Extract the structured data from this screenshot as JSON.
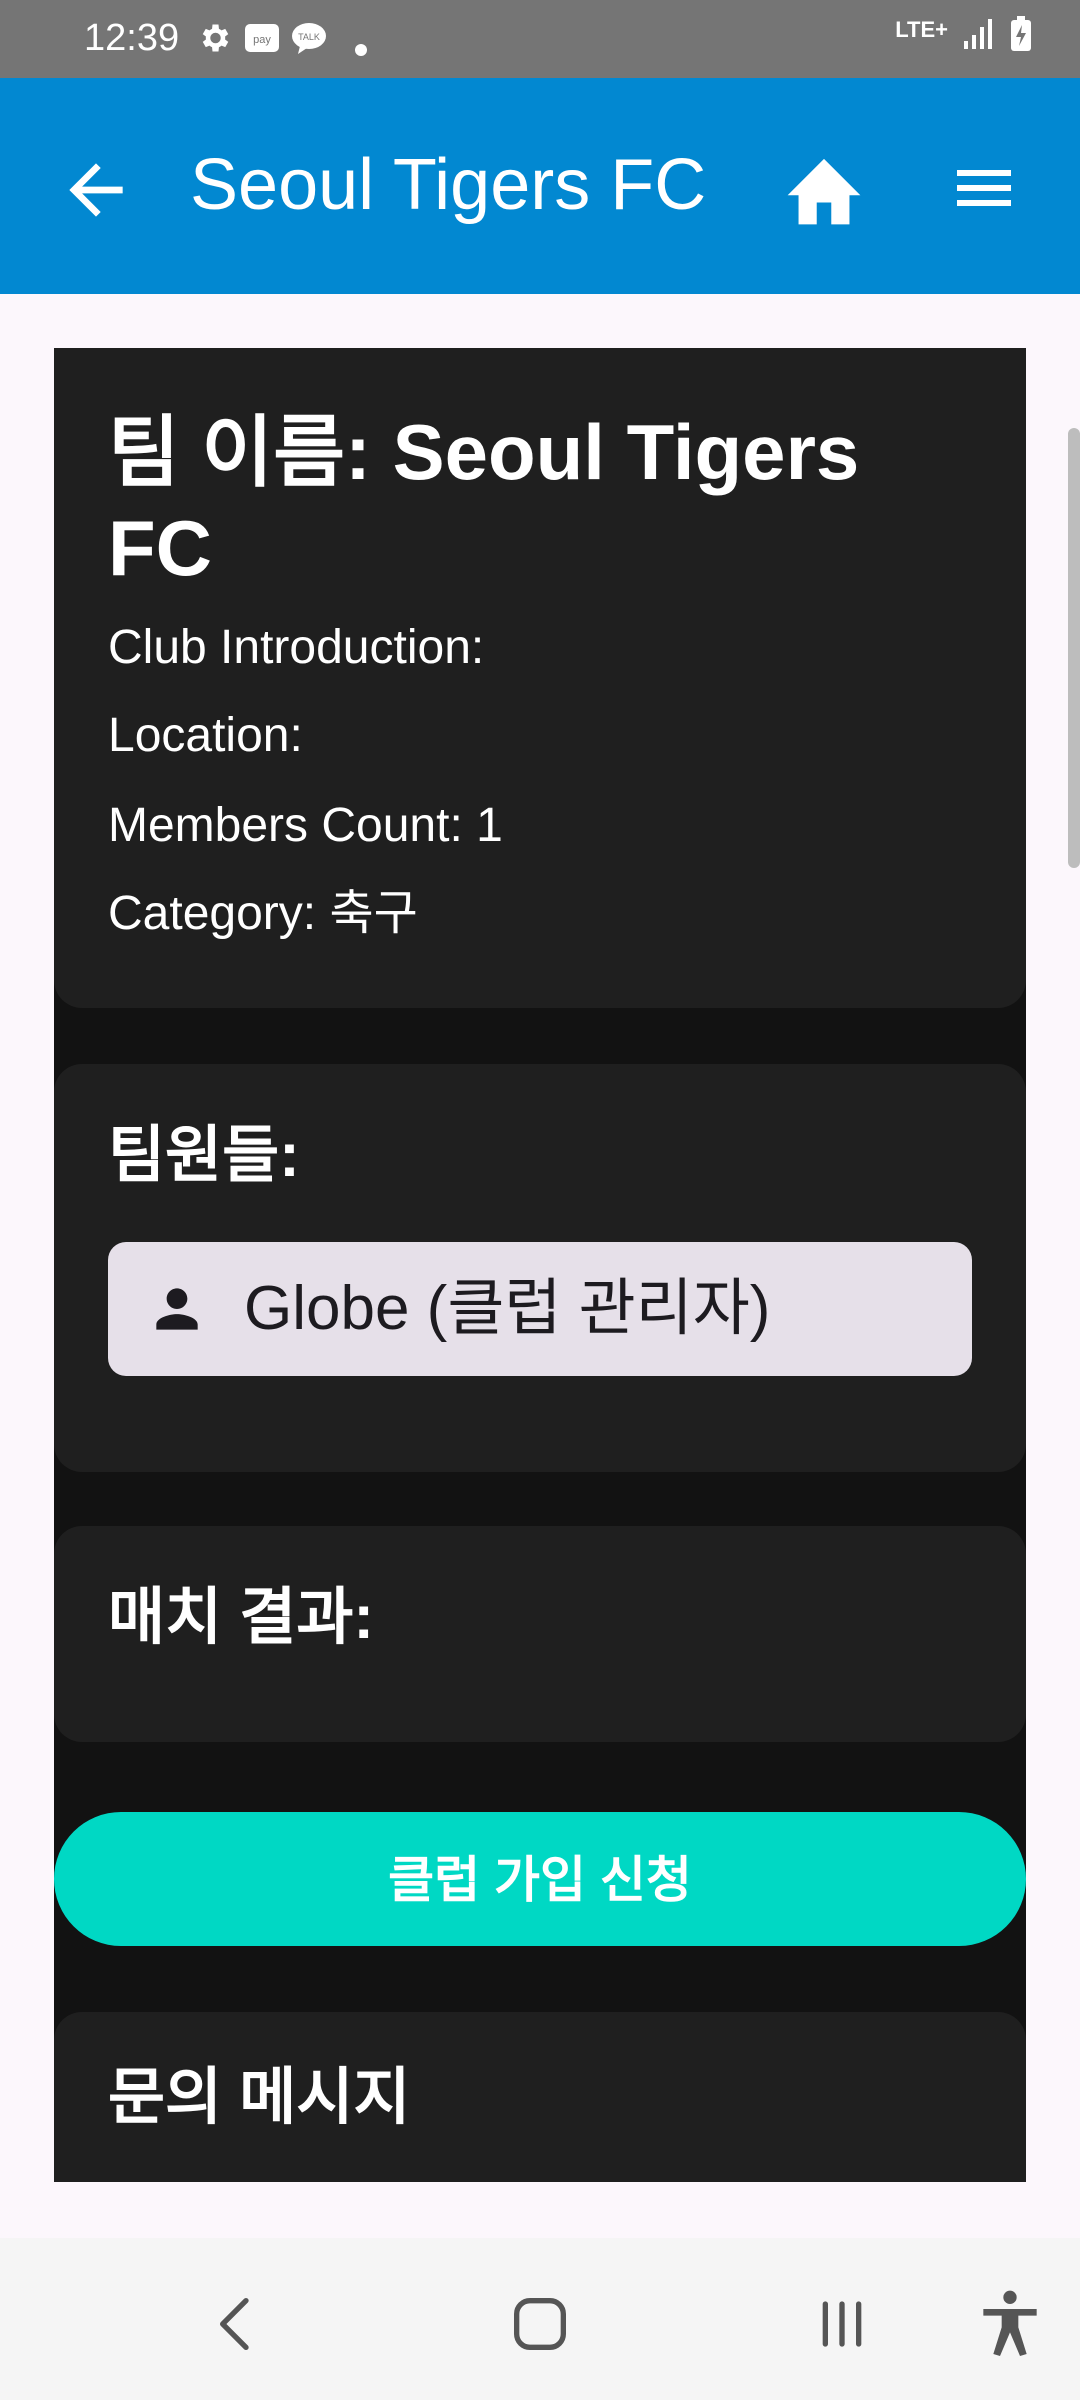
{
  "status_bar": {
    "time": "12:39",
    "left_icons": [
      "settings-icon",
      "pay-icon",
      "talk-icon",
      "dot-icon"
    ],
    "network": "LTE+",
    "right_icons": [
      "signal-icon",
      "battery-icon"
    ]
  },
  "app_bar": {
    "title": "Seoul Tigers FC",
    "back_icon": "arrow-back-icon",
    "home_icon": "home-icon",
    "menu_icon": "menu-icon",
    "color": "#0288d1"
  },
  "team": {
    "name": "팀 이름: Seoul Tigers FC",
    "introduction": "Club Introduction:",
    "location": "Location:",
    "members_count": "Members Count: 1",
    "category": "Category: 축구"
  },
  "members_section": {
    "title": "팀원들:",
    "members": [
      {
        "icon": "person-icon",
        "label": "Globe (클럽 관리자)"
      }
    ]
  },
  "matches_section": {
    "title": "매치 결과:"
  },
  "join_button": {
    "label": "클럽 가입 신청",
    "color": "#00d8c4"
  },
  "inquiry_section": {
    "title": "문의 메시지"
  },
  "nav_bar": {
    "icons": [
      "nav-back-icon",
      "nav-home-icon",
      "nav-recents-icon",
      "accessibility-icon"
    ]
  }
}
